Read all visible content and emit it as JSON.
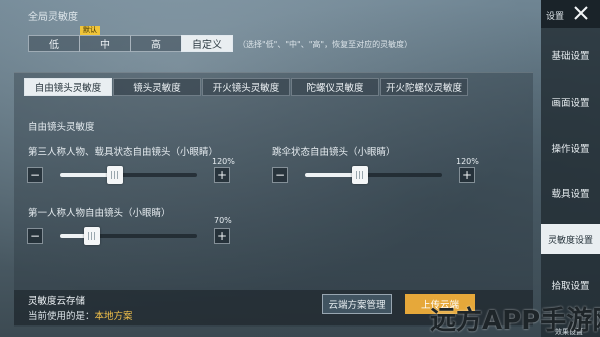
{
  "sensitivity": {
    "title": "全局灵敏度",
    "default_badge": "默认",
    "options": [
      "低",
      "中",
      "高",
      "自定义"
    ],
    "hint": "（选择\"低\"、\"中\"、\"高\"，恢复至对应的灵敏度）"
  },
  "tabs": [
    "自由镜头灵敏度",
    "镜头灵敏度",
    "开火镜头灵敏度",
    "陀螺仪灵敏度",
    "开火陀螺仪灵敏度"
  ],
  "section_label": "自由镜头灵敏度",
  "sliders": [
    {
      "label": "第三人称人物、载具状态自由镜头（小眼睛）",
      "value_label": "120%",
      "value": 120,
      "max": 300
    },
    {
      "label": "跳伞状态自由镜头（小眼睛）",
      "value_label": "120%",
      "value": 120,
      "max": 300
    },
    {
      "label": "第一人称人物自由镜头（小眼睛）",
      "value_label": "70%",
      "value": 70,
      "max": 300
    }
  ],
  "stepper": {
    "minus": "−",
    "plus": "+"
  },
  "cloud": {
    "title": "灵敏度云存储",
    "desc_prefix": "当前使用的是：",
    "desc_value": "本地方案",
    "manage_button": "云端方案管理",
    "upload_button": "上传云端"
  },
  "sidebar": {
    "header": "设置",
    "items": [
      "基础设置",
      "画面设置",
      "操作设置",
      "载具设置",
      "灵敏度设置",
      "拾取设置"
    ],
    "bottom_text": "效果设置"
  },
  "watermark": "远方APP手游网",
  "colors": {
    "accent": "#e6a83a",
    "highlight": "#f2c14a",
    "active_tab": "#e9eef1"
  }
}
